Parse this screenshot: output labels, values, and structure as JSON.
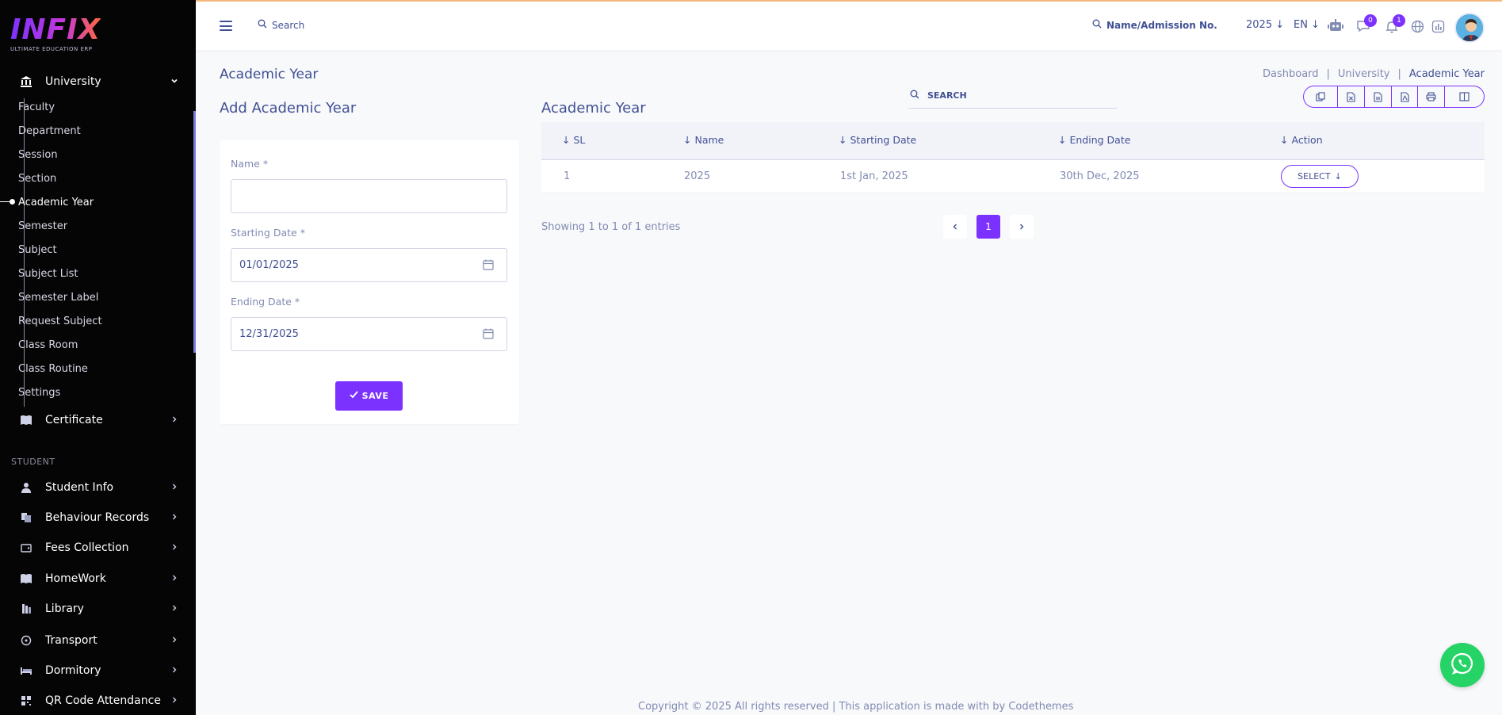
{
  "brand": {
    "name": "INFIX",
    "tagline": "ULTIMATE EDUCATION ERP"
  },
  "sidebar": {
    "university": {
      "label": "University",
      "icon": "university-icon"
    },
    "university_items": [
      {
        "label": "Faculty"
      },
      {
        "label": "Department"
      },
      {
        "label": "Session"
      },
      {
        "label": "Section"
      },
      {
        "label": "Academic Year",
        "active": true
      },
      {
        "label": "Semester"
      },
      {
        "label": "Subject"
      },
      {
        "label": "Subject List"
      },
      {
        "label": "Semester Label"
      },
      {
        "label": "Request Subject"
      },
      {
        "label": "Class Room"
      },
      {
        "label": "Class Routine"
      },
      {
        "label": "Settings"
      }
    ],
    "certificate": {
      "label": "Certificate",
      "icon": "book-icon"
    },
    "section_student": "STUDENT",
    "student_groups": [
      {
        "label": "Student Info",
        "icon": "user-icon"
      },
      {
        "label": "Behaviour Records",
        "icon": "records-icon"
      },
      {
        "label": "Fees Collection",
        "icon": "wallet-icon"
      },
      {
        "label": "HomeWork",
        "icon": "book-open-icon"
      },
      {
        "label": "Library",
        "icon": "library-icon"
      },
      {
        "label": "Transport",
        "icon": "transport-icon"
      },
      {
        "label": "Dormitory",
        "icon": "bed-icon"
      },
      {
        "label": "QR Code Attendance",
        "icon": "qr-icon"
      }
    ]
  },
  "topbar": {
    "search_label": "Search",
    "student_search_label": "Name/Admission No.",
    "year": "2025",
    "lang": "EN",
    "chat_count": "0",
    "notification_count": "1"
  },
  "page": {
    "title": "Academic Year",
    "breadcrumb": [
      "Dashboard",
      "University",
      "Academic Year"
    ]
  },
  "form": {
    "heading": "Add Academic Year",
    "name_label": "Name *",
    "name_value": "",
    "start_label": "Starting Date *",
    "start_value": "01/01/2025",
    "end_label": "Ending Date *",
    "end_value": "12/31/2025",
    "save_label": "SAVE"
  },
  "list": {
    "heading": "Academic Year",
    "search_label": "SEARCH",
    "columns": [
      "SL",
      "Name",
      "Starting Date",
      "Ending Date",
      "Action"
    ],
    "rows": [
      {
        "sl": "1",
        "name": "2025",
        "start": "1st Jan, 2025",
        "end": "30th Dec, 2025",
        "action": "SELECT"
      }
    ],
    "entries_text": "Showing 1 to 1 of 1 entries",
    "current_page": "1"
  },
  "footer": {
    "text": "Copyright © 2025 All rights reserved | This application is made with by Codethemes"
  },
  "colors": {
    "accent": "#7c32ff",
    "sidebar_bg": "#050505",
    "text": "#415094",
    "muted": "#828bb2",
    "whatsapp": "#25d366"
  }
}
